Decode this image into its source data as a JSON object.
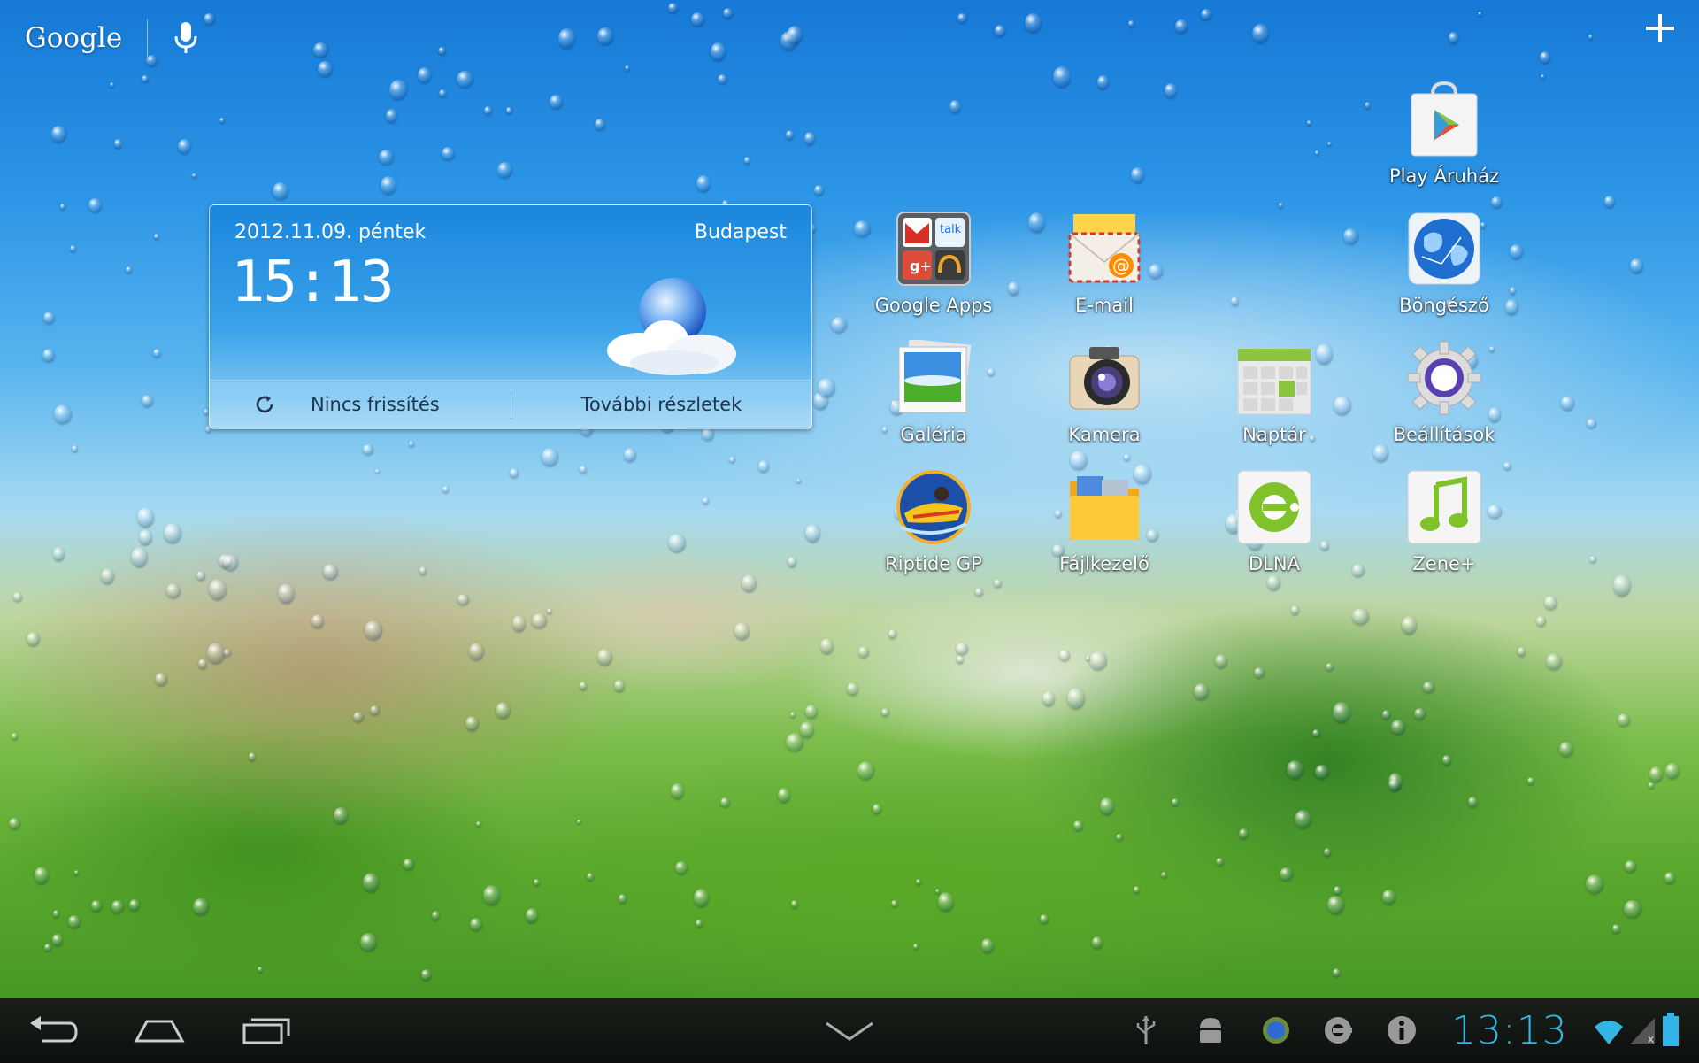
{
  "search": {
    "logo_text": "Google",
    "voice_icon": "microphone-icon",
    "add_icon": "plus-icon"
  },
  "weather_widget": {
    "date": "2012.11.09.  péntek",
    "city": "Budapest",
    "time": "15:13",
    "refresh_label": "Nincs frissítés",
    "details_label": "További részletek",
    "refresh_icon": "refresh-icon",
    "condition_icon": "moon-cloud-icon"
  },
  "apps": [
    {
      "label": "Play Áruház",
      "icon": "play-store-icon"
    },
    {
      "label": "Google Apps",
      "icon": "google-apps-folder-icon"
    },
    {
      "label": "E-mail",
      "icon": "email-icon"
    },
    {
      "label": "Böngésző",
      "icon": "browser-globe-icon"
    },
    {
      "label": "Galéria",
      "icon": "gallery-icon"
    },
    {
      "label": "Kamera",
      "icon": "camera-icon"
    },
    {
      "label": "Naptár",
      "icon": "calendar-icon"
    },
    {
      "label": "Beállítások",
      "icon": "settings-gear-icon"
    },
    {
      "label": "Riptide GP",
      "icon": "riptide-gp-icon"
    },
    {
      "label": "Fájlkezelő",
      "icon": "file-manager-folder-icon"
    },
    {
      "label": "DLNA",
      "icon": "dlna-icon"
    },
    {
      "label": "Zene+",
      "icon": "music-note-icon"
    }
  ],
  "google_apps_folder": [
    "talk"
  ],
  "status_bar": {
    "time": "13:13",
    "icons": [
      "usb-icon",
      "android-debug-icon",
      "sync-app-icon",
      "dlna-notification-icon",
      "info-icon",
      "wifi-icon",
      "signal-icon",
      "battery-icon"
    ]
  },
  "colors": {
    "clock": "#33b5e5",
    "nav_bar": "#0c0f0c",
    "widget_blue": "#1b86dc"
  }
}
